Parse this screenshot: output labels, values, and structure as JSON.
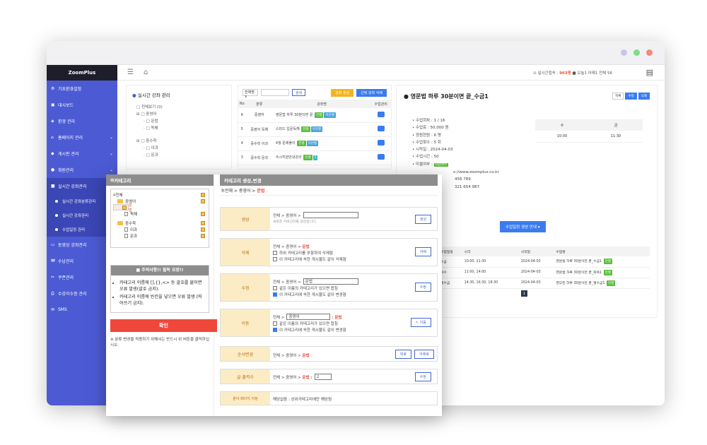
{
  "app": {
    "logo": "ZoomPlus"
  },
  "topbar": {
    "info_prefix": "⊙ 실시간접속 :",
    "online_count": "963명",
    "info_rest": "■ 오늘1 어제1 전체 56"
  },
  "sidebar": {
    "items": [
      {
        "label": "기초환경설정",
        "icon": "⚙"
      },
      {
        "label": "대시보드",
        "icon": "▣"
      },
      {
        "label": "환경 관리",
        "icon": "◈"
      },
      {
        "label": "홈페이지 관리",
        "icon": "⌂"
      },
      {
        "label": "게시판 관리",
        "icon": "◆"
      },
      {
        "label": "회원관리",
        "icon": "●"
      },
      {
        "label": "실시간 강좌관리",
        "icon": "■"
      }
    ],
    "subitems": [
      "실시간 강좌분류관리",
      "실시간 강좌관리",
      "수업일정 관리"
    ],
    "items2": [
      {
        "label": "동영상 강좌관리",
        "icon": "▭"
      },
      {
        "label": "수납관리",
        "icon": "₩"
      },
      {
        "label": "쿠폰관리",
        "icon": "✂"
      },
      {
        "label": "수강이수증 관리",
        "icon": "⎙"
      },
      {
        "label": "SMS",
        "icon": "✉"
      }
    ]
  },
  "pane1": {
    "title": "실시간 강좌 관리",
    "tree": [
      "□ 전체보기 (0)",
      "⊟ □ 중영어",
      "· □ 문법",
      "· □ 독해",
      "⊟ □ 중수학",
      "· □ 이과",
      "· □ 문과"
    ]
  },
  "pane2": {
    "select": "전체명 ∨",
    "search_btn": "검색",
    "btn_yellow": "강좌 생성",
    "btn_blue": "선택 강좌 삭제",
    "headers": [
      "No",
      "분류",
      "강좌명",
      "수업관리"
    ],
    "rows": [
      {
        "no": "6",
        "cat": "중영어",
        "title": "영문법 하루 30분이면 끝",
        "b1": "진행",
        "b2": "미진행"
      },
      {
        "no": "5",
        "cat": "중영어 독해",
        "title": "스피드 입문독해",
        "b1": "진행",
        "b2": "미진행"
      },
      {
        "no": "4",
        "cat": "중수학 이과",
        "title": "4월 문제풀이",
        "b1": "진행",
        "b2": "미진행"
      },
      {
        "no": "3",
        "cat": "중수학 문과",
        "title": "수시지원안내강의",
        "b1": "진행",
        "b2": "1"
      }
    ]
  },
  "pane3": {
    "title": "영문법 하루 30분이면 끝_수금1",
    "buttons": [
      "목록",
      "수정",
      "삭제"
    ],
    "info": [
      "수업회차 : 1 / 16",
      "수업료 : 50,000 원",
      "정원현원 : 6 명",
      "수업횟수 : 5 회",
      "시작일 : 2024-04-03",
      "수업시간 : 50",
      "미결여부 :",
      "s://www.zoomplus.co.kr",
      "456 789",
      "321 654 987"
    ],
    "info_badge": "미결여부",
    "mini_headers": [
      "수",
      "금"
    ],
    "mini_row": [
      "10:00",
      "11:30"
    ],
    "guide_btn": "수업일정 생성 안내 ▾",
    "sched_headers": [
      "수업일정",
      "시각",
      "시작일",
      "수업명"
    ],
    "sched_rows": [
      [
        "수금",
        "10:00, 11:30",
        "2024-04-03",
        "영문법 하루 30분이면 끝_수금1",
        "진행"
      ],
      [
        "화수",
        "11:00, 14:00",
        "2024-04-03",
        "영문법 하루 30분이면 끝_화목1",
        "진행"
      ],
      [
        "월수금",
        "14:30, 16:30, 18:30",
        "2024-04-03",
        "영모든 하루 30분이면 끝_월수금1",
        "진행"
      ]
    ],
    "page": "1"
  },
  "modal": {
    "left_title": "카테고리",
    "tree": [
      {
        "label": "전체",
        "type": "root"
      },
      {
        "label": "중영어",
        "type": "folder"
      },
      {
        "label": "문법",
        "type": "page",
        "selected": true
      },
      {
        "label": "독해",
        "type": "page"
      },
      {
        "label": "중수학",
        "type": "folder"
      },
      {
        "label": "이과",
        "type": "page"
      },
      {
        "label": "문과",
        "type": "page"
      }
    ],
    "warn_title": "■ 주의사항!! 필독 요망!!",
    "warn_items": [
      "카테고리 이름에 [],{},<> 등 괄호를 붙이면 오류 발생(괄호 금지).",
      "카테고리 이름에 빈칸을 넣으면 오류 발생 (띄어쓰기 금지)."
    ],
    "confirm": "확인",
    "note": "※ 분류 변경을 적용하기 위해서는 반드시 위 버튼을 클릭하십시오.",
    "right_title": "카테고리 생성,변경",
    "breadcrumb_prefix": "전체 > 중영어 >",
    "breadcrumb_current": "문법",
    "rows": {
      "create": {
        "label": "생성",
        "path": "전체 > 중영어 >",
        "hint": "새로운 카테고리를 생성합니다.",
        "btn": "생성"
      },
      "delete": {
        "label": "삭제",
        "path": "전체 > 중영어 >",
        "current": "문법",
        "opt1": "하위 카테고리를 포함하여 삭제함",
        "opt2": "이 카테고리에 속한 게시물도 같이 삭제함",
        "btn": "삭제"
      },
      "edit": {
        "label": "수정",
        "path": "전체 > 중영어 >",
        "value": "문법",
        "opt1": "같은 이름의 카테고리가 있으면 합침",
        "opt2": "이 카테고리에 속한 게시물도 같이 변경함",
        "btn": "수정"
      },
      "move": {
        "label": "이동",
        "path": "전체 >",
        "value": "중영어",
        "current": ": 문법",
        "opt1": "같은 이름의 카테고리가 있으면 합침",
        "opt2": "이 카테고리에 속한 게시물도 같이 변경함",
        "btn": "↖ 이동"
      },
      "order": {
        "label": "순서변경",
        "path": "전체 > 중영어 >",
        "current": "문법",
        "btn_up": "위로",
        "btn_down": "아래로"
      },
      "count": {
        "label": "글 출력수",
        "path": "전체 > 중영어 >",
        "current": "문법 :",
        "value": "2",
        "btn": "수정"
      },
      "default": {
        "label": "분야 페이지 지정",
        "text": "해당없음 : 상위카테고리에만 해당됨"
      }
    }
  },
  "colors": {
    "sidebar": "#4c5bd4",
    "accent_blue": "#3a7cf0",
    "confirm_red": "#f0473b",
    "label_bg": "#fbecc5"
  }
}
